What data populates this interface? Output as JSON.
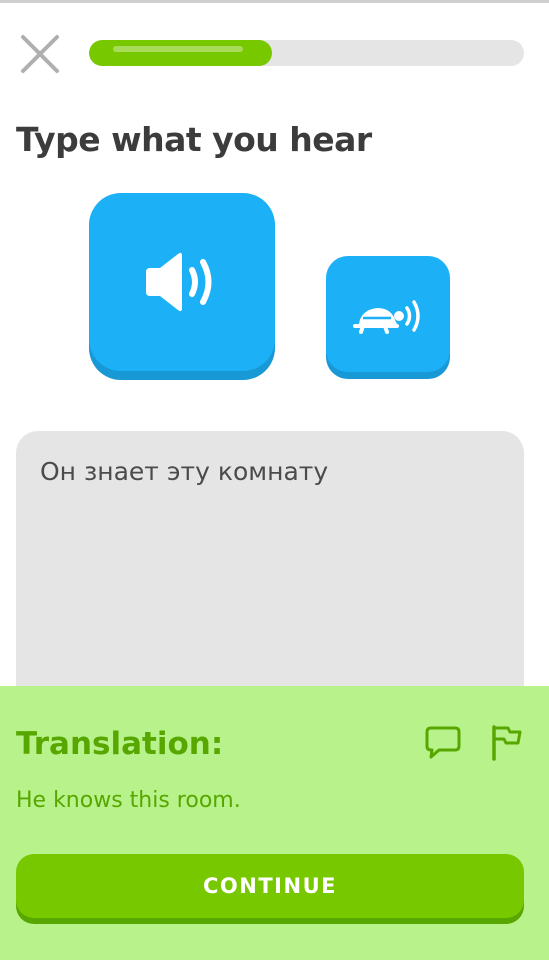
{
  "header": {
    "close_icon": "close-icon",
    "progress": 0.42,
    "colors": {
      "progress_fill": "#78c800",
      "progress_track": "#e5e5e5"
    }
  },
  "exercise": {
    "prompt": "Type what you hear",
    "audio_normal_icon": "speaker-icon",
    "audio_slow_icon": "turtle-speaker-icon",
    "answer_value": "Он знает эту комнату"
  },
  "feedback": {
    "title": "Translation:",
    "text": "He knows this room.",
    "discuss_icon": "speech-bubble-icon",
    "report_icon": "flag-icon",
    "continue_label": "CONTINUE",
    "colors": {
      "background": "#b8f28b",
      "text": "#58a700",
      "button": "#78c800",
      "audio_button": "#1cb0f6"
    }
  }
}
